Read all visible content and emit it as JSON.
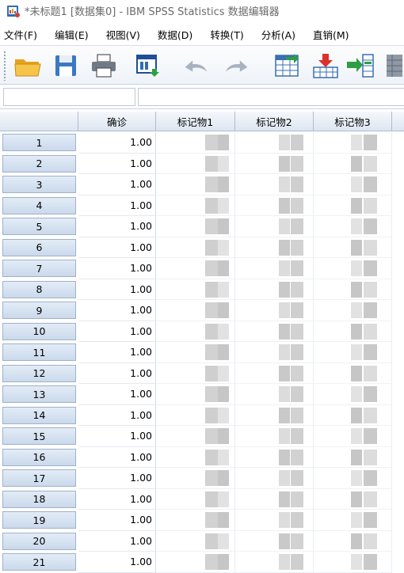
{
  "window": {
    "title": "*未标题1 [数据集0] - IBM SPSS Statistics 数据编辑器"
  },
  "menu": [
    {
      "label": "文件(F)",
      "name": "menu-file"
    },
    {
      "label": "编辑(E)",
      "name": "menu-edit"
    },
    {
      "label": "视图(V)",
      "name": "menu-view"
    },
    {
      "label": "数据(D)",
      "name": "menu-data"
    },
    {
      "label": "转换(T)",
      "name": "menu-transform"
    },
    {
      "label": "分析(A)",
      "name": "menu-analyze"
    },
    {
      "label": "直销(M)",
      "name": "menu-direct-marketing"
    }
  ],
  "toolbar": [
    {
      "icon": "open-folder-icon",
      "name": "open-button"
    },
    {
      "icon": "save-icon",
      "name": "save-button"
    },
    {
      "icon": "print-icon",
      "name": "print-button"
    },
    {
      "icon": "recall-dialog-icon",
      "name": "recall-dialog-button"
    },
    {
      "icon": "undo-icon",
      "name": "undo-button"
    },
    {
      "icon": "redo-icon",
      "name": "redo-button"
    },
    {
      "icon": "goto-case-icon",
      "name": "goto-case-button"
    },
    {
      "icon": "insert-case-icon",
      "name": "insert-case-button"
    },
    {
      "icon": "insert-variable-icon",
      "name": "insert-variable-button"
    },
    {
      "icon": "split-file-icon",
      "name": "split-file-button"
    }
  ],
  "columns": [
    "确诊",
    "标记物1",
    "标记物2",
    "标记物3"
  ],
  "rows": [
    {
      "id": "1",
      "value": "1.00"
    },
    {
      "id": "2",
      "value": "1.00"
    },
    {
      "id": "3",
      "value": "1.00"
    },
    {
      "id": "4",
      "value": "1.00"
    },
    {
      "id": "5",
      "value": "1.00"
    },
    {
      "id": "6",
      "value": "1.00"
    },
    {
      "id": "7",
      "value": "1.00"
    },
    {
      "id": "8",
      "value": "1.00"
    },
    {
      "id": "9",
      "value": "1.00"
    },
    {
      "id": "10",
      "value": "1.00"
    },
    {
      "id": "11",
      "value": "1.00"
    },
    {
      "id": "12",
      "value": "1.00"
    },
    {
      "id": "13",
      "value": "1.00"
    },
    {
      "id": "14",
      "value": "1.00"
    },
    {
      "id": "15",
      "value": "1.00"
    },
    {
      "id": "16",
      "value": "1.00"
    },
    {
      "id": "17",
      "value": "1.00"
    },
    {
      "id": "18",
      "value": "1.00"
    },
    {
      "id": "19",
      "value": "1.00"
    },
    {
      "id": "20",
      "value": "1.00"
    },
    {
      "id": "21",
      "value": "1.00"
    }
  ],
  "colors": {
    "header_bg": "#dde6f1",
    "rowheader_bg": "#cad9eb",
    "grid_line": "#d5dde6",
    "pixelation": "#c8c8c8"
  }
}
